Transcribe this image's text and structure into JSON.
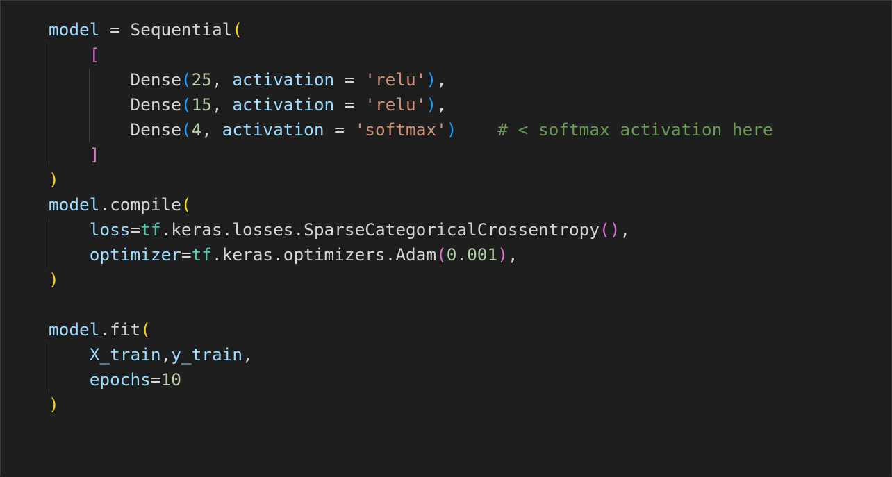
{
  "colors": {
    "background": "#1e1e1e",
    "variable": "#9cdcfe",
    "plain": "#d4d4d4",
    "number": "#b5cea8",
    "string": "#ce9178",
    "comment": "#6a9955",
    "module": "#4ec9b0",
    "bracket_level_1": "#ffd700",
    "bracket_level_2": "#da70d6",
    "bracket_level_3": "#179fff"
  },
  "lines": [
    [
      [
        "var",
        "model"
      ],
      [
        "op",
        " = "
      ],
      [
        "fn",
        "Sequential"
      ],
      [
        "br1",
        "("
      ]
    ],
    [
      [
        "op",
        "    "
      ],
      [
        "br2",
        "["
      ]
    ],
    [
      [
        "op",
        "        "
      ],
      [
        "fn",
        "Dense"
      ],
      [
        "br3",
        "("
      ],
      [
        "num",
        "25"
      ],
      [
        "op",
        ", "
      ],
      [
        "var",
        "activation"
      ],
      [
        "op",
        " = "
      ],
      [
        "str",
        "'relu'"
      ],
      [
        "br3",
        ")"
      ],
      [
        "op",
        ","
      ]
    ],
    [
      [
        "op",
        "        "
      ],
      [
        "fn",
        "Dense"
      ],
      [
        "br3",
        "("
      ],
      [
        "num",
        "15"
      ],
      [
        "op",
        ", "
      ],
      [
        "var",
        "activation"
      ],
      [
        "op",
        " = "
      ],
      [
        "str",
        "'relu'"
      ],
      [
        "br3",
        ")"
      ],
      [
        "op",
        ","
      ]
    ],
    [
      [
        "op",
        "        "
      ],
      [
        "fn",
        "Dense"
      ],
      [
        "br3",
        "("
      ],
      [
        "num",
        "4"
      ],
      [
        "op",
        ", "
      ],
      [
        "var",
        "activation"
      ],
      [
        "op",
        " = "
      ],
      [
        "str",
        "'softmax'"
      ],
      [
        "br3",
        ")"
      ],
      [
        "op",
        "    "
      ],
      [
        "cmt",
        "# < softmax activation here"
      ]
    ],
    [
      [
        "op",
        "    "
      ],
      [
        "br2",
        "]"
      ]
    ],
    [
      [
        "br1",
        ")"
      ]
    ],
    [
      [
        "var",
        "model"
      ],
      [
        "op",
        "."
      ],
      [
        "fn",
        "compile"
      ],
      [
        "br1",
        "("
      ]
    ],
    [
      [
        "op",
        "    "
      ],
      [
        "var",
        "loss"
      ],
      [
        "op",
        "="
      ],
      [
        "mod",
        "tf"
      ],
      [
        "op",
        ".keras.losses."
      ],
      [
        "fn",
        "SparseCategoricalCrossentropy"
      ],
      [
        "br2",
        "()"
      ],
      [
        "op",
        ","
      ]
    ],
    [
      [
        "op",
        "    "
      ],
      [
        "var",
        "optimizer"
      ],
      [
        "op",
        "="
      ],
      [
        "mod",
        "tf"
      ],
      [
        "op",
        ".keras.optimizers."
      ],
      [
        "fn",
        "Adam"
      ],
      [
        "br2",
        "("
      ],
      [
        "num",
        "0.001"
      ],
      [
        "br2",
        ")"
      ],
      [
        "op",
        ","
      ]
    ],
    [
      [
        "br1",
        ")"
      ]
    ],
    [
      [
        "op",
        " "
      ]
    ],
    [
      [
        "var",
        "model"
      ],
      [
        "op",
        "."
      ],
      [
        "fn",
        "fit"
      ],
      [
        "br1",
        "("
      ]
    ],
    [
      [
        "op",
        "    "
      ],
      [
        "var",
        "X_train"
      ],
      [
        "op",
        ","
      ],
      [
        "var",
        "y_train"
      ],
      [
        "op",
        ","
      ]
    ],
    [
      [
        "op",
        "    "
      ],
      [
        "var",
        "epochs"
      ],
      [
        "op",
        "="
      ],
      [
        "num",
        "10"
      ]
    ],
    [
      [
        "br1",
        ")"
      ]
    ]
  ]
}
